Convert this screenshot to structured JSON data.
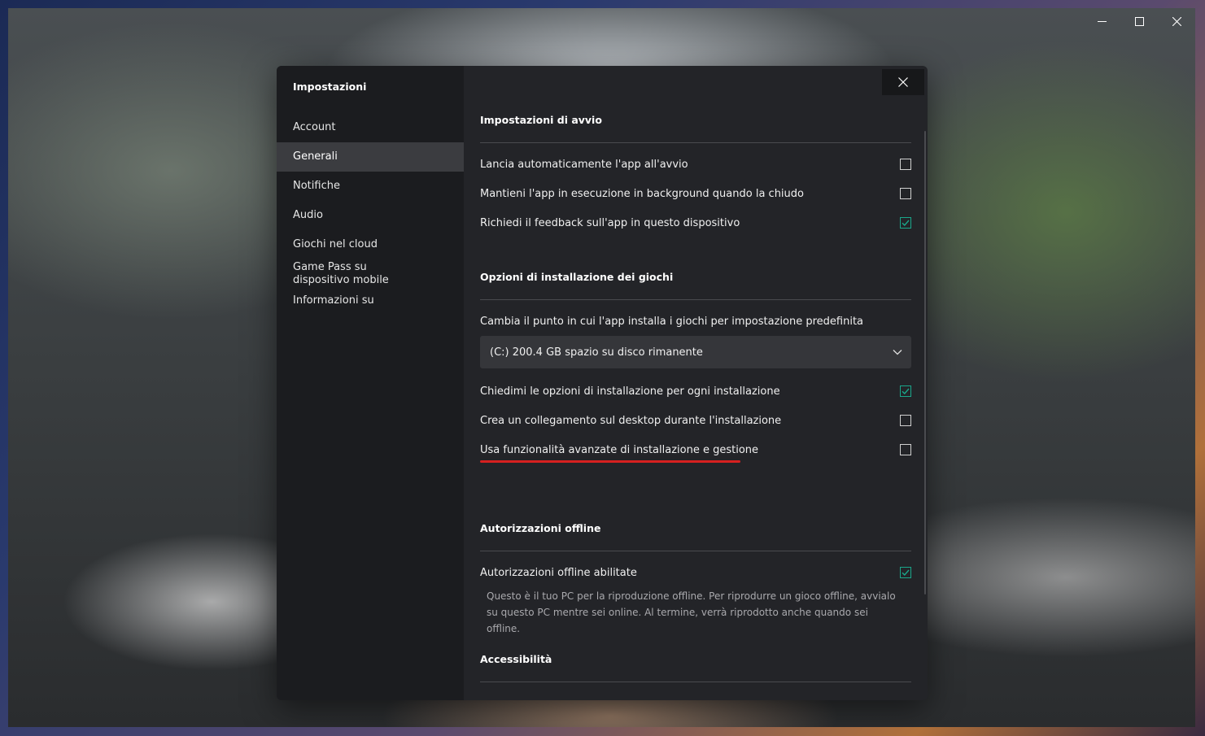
{
  "window": {
    "minimize_label": "Riduci a icona",
    "maximize_label": "Ingrandisci",
    "close_label": "Chiudi"
  },
  "sidebar": {
    "title": "Impostazioni",
    "items": [
      {
        "label": "Account",
        "active": false
      },
      {
        "label": "Generali",
        "active": true
      },
      {
        "label": "Notifiche",
        "active": false
      },
      {
        "label": "Audio",
        "active": false
      },
      {
        "label": "Giochi nel cloud",
        "active": false
      },
      {
        "label": "Game Pass su dispositivo mobile",
        "active": false
      },
      {
        "label": "Informazioni su",
        "active": false
      }
    ]
  },
  "sections": {
    "startup": {
      "title": "Impostazioni di avvio",
      "options": [
        {
          "label": "Lancia automaticamente l'app all'avvio",
          "checked": false
        },
        {
          "label": "Mantieni l'app in esecuzione in background quando la chiudo",
          "checked": false
        },
        {
          "label": "Richiedi il feedback sull'app in questo dispositivo",
          "checked": true
        }
      ]
    },
    "install": {
      "title": "Opzioni di installazione dei giochi",
      "location_label": "Cambia il punto in cui l'app installa i giochi per impostazione predefinita",
      "location_value": "(C:) 200.4 GB spazio su disco rimanente",
      "options": [
        {
          "label": "Chiedimi le opzioni di installazione per ogni installazione",
          "checked": true
        },
        {
          "label": "Crea un collegamento sul desktop durante l'installazione",
          "checked": false
        },
        {
          "label": "Usa funzionalità avanzate di installazione e gestione",
          "checked": false
        }
      ]
    },
    "offline": {
      "title": "Autorizzazioni offline",
      "option": {
        "label": "Autorizzazioni offline abilitate",
        "checked": true
      },
      "description": "Questo è il tuo PC per la riproduzione offline. Per riprodurre un gioco offline, avvialo su questo PC mentre sei online. Al termine, verrà riprodotto anche quando sei offline."
    },
    "accessibility": {
      "title": "Accessibilità"
    }
  },
  "colors": {
    "check_accent": "#1aa68a",
    "highlight_underline": "#d62020"
  }
}
